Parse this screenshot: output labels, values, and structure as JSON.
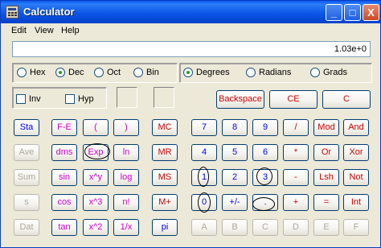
{
  "window": {
    "title": "Calculator",
    "icon": "calculator-icon"
  },
  "caption": {
    "minimize": "_",
    "maximize": "□",
    "close": "X"
  },
  "menu": {
    "edit": "Edit",
    "view": "View",
    "help": "Help"
  },
  "display": {
    "value": "1.03e+0"
  },
  "base": {
    "hex": "Hex",
    "dec": "Dec",
    "oct": "Oct",
    "bin": "Bin",
    "selected": "Dec"
  },
  "angle": {
    "degrees": "Degrees",
    "radians": "Radians",
    "grads": "Grads",
    "selected": "Degrees"
  },
  "options": {
    "inv": "Inv",
    "hyp": "Hyp"
  },
  "edit_keys": {
    "backspace": "Backspace",
    "ce": "CE",
    "c": "C"
  },
  "memory_keys": {
    "sta": "Sta",
    "ave": "Ave",
    "sum": "Sum",
    "s": "s",
    "dat": "Dat"
  },
  "sci_keys": {
    "fe": "F-E",
    "lparen": "(",
    "rparen": ")",
    "dms": "dms",
    "exp": "Exp",
    "ln": "ln",
    "sin": "sin",
    "xy": "x^y",
    "log": "log",
    "cos": "cos",
    "x3": "x^3",
    "nfact": "n!",
    "tan": "tan",
    "x2": "x^2",
    "recip": "1/x"
  },
  "mem_keys": {
    "mc": "MC",
    "mr": "MR",
    "ms": "MS",
    "mplus": "M+",
    "pi": "pi"
  },
  "num_keys": {
    "n7": "7",
    "n8": "8",
    "n9": "9",
    "n4": "4",
    "n5": "5",
    "n6": "6",
    "n1": "1",
    "n2": "2",
    "n3": "3",
    "n0": "0",
    "sign": "+/-",
    "dot": ".",
    "a": "A",
    "b": "B",
    "c": "C",
    "d": "D",
    "e": "E",
    "f": "F"
  },
  "op_keys": {
    "div": "/",
    "mod": "Mod",
    "and": "And",
    "mul": "*",
    "or": "Or",
    "xor": "Xor",
    "sub": "-",
    "lsh": "Lsh",
    "not": "Not",
    "add": "+",
    "eq": "=",
    "int": "Int"
  }
}
